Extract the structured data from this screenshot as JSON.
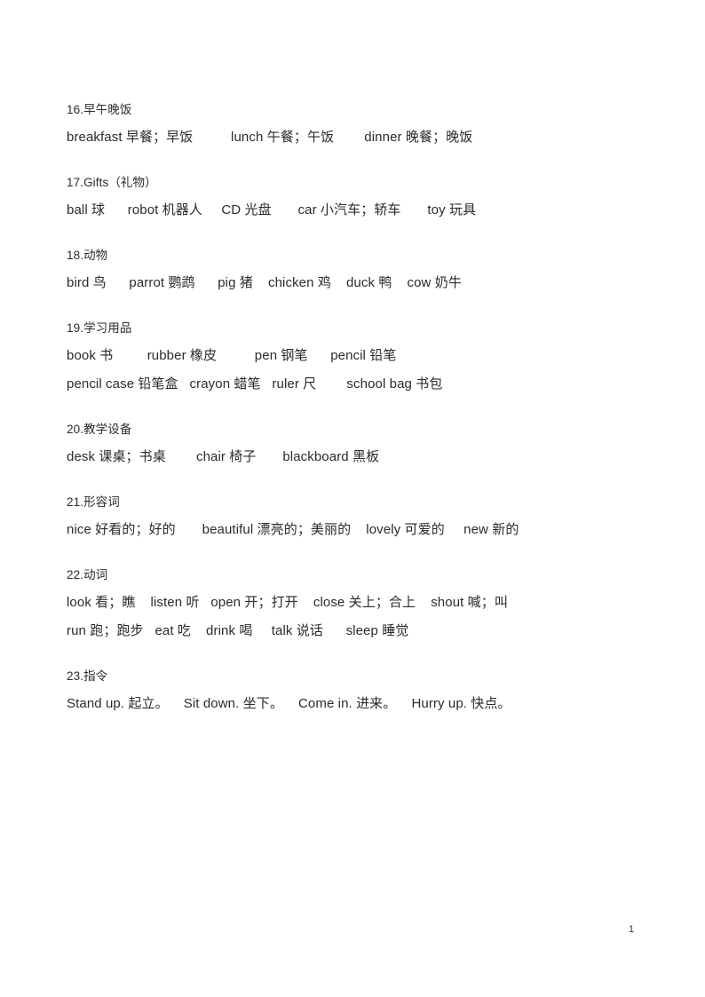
{
  "document": {
    "page_number": "1",
    "background_color": "#ffffff",
    "text_color": "#2b2b2b"
  },
  "sections": [
    {
      "heading": "16.早午晚饭",
      "lines": [
        "breakfast 早餐；早饭          lunch 午餐；午饭        dinner 晚餐；晚饭"
      ],
      "entries": [
        {
          "en": "breakfast",
          "zh": "早餐；早饭"
        },
        {
          "en": "lunch",
          "zh": "午餐；午饭"
        },
        {
          "en": "dinner",
          "zh": "晚餐；晚饭"
        }
      ]
    },
    {
      "heading": "17.Gifts（礼物）",
      "lines": [
        "ball 球      robot 机器人     CD 光盘       car 小汽车；轿车       toy 玩具"
      ],
      "entries": [
        {
          "en": "ball",
          "zh": "球"
        },
        {
          "en": "robot",
          "zh": "机器人"
        },
        {
          "en": "CD",
          "zh": "光盘"
        },
        {
          "en": "car",
          "zh": "小汽车；轿车"
        },
        {
          "en": "toy",
          "zh": "玩具"
        }
      ]
    },
    {
      "heading": "18.动物",
      "lines": [
        "bird 鸟      parrot 鹦鹉      pig 猪    chicken 鸡    duck 鸭    cow 奶牛"
      ],
      "entries": [
        {
          "en": "bird",
          "zh": "鸟"
        },
        {
          "en": "parrot",
          "zh": "鹦鹉"
        },
        {
          "en": "pig",
          "zh": "猪"
        },
        {
          "en": "chicken",
          "zh": "鸡"
        },
        {
          "en": "duck",
          "zh": "鸭"
        },
        {
          "en": "cow",
          "zh": "奶牛"
        }
      ]
    },
    {
      "heading": "19.学习用品",
      "lines": [
        "book 书         rubber 橡皮          pen 钢笔      pencil 铅笔",
        "pencil case 铅笔盒   crayon 蜡笔   ruler 尺        school bag 书包"
      ],
      "entries": [
        {
          "en": "book",
          "zh": "书"
        },
        {
          "en": "rubber",
          "zh": "橡皮"
        },
        {
          "en": "pen",
          "zh": "钢笔"
        },
        {
          "en": "pencil",
          "zh": "铅笔"
        },
        {
          "en": "pencil case",
          "zh": "铅笔盒"
        },
        {
          "en": "crayon",
          "zh": "蜡笔"
        },
        {
          "en": "ruler",
          "zh": "尺"
        },
        {
          "en": "school bag",
          "zh": "书包"
        }
      ]
    },
    {
      "heading": "20.教学设备",
      "lines": [
        "desk 课桌；书桌        chair 椅子       blackboard 黑板"
      ],
      "entries": [
        {
          "en": "desk",
          "zh": "课桌；书桌"
        },
        {
          "en": "chair",
          "zh": "椅子"
        },
        {
          "en": "blackboard",
          "zh": "黑板"
        }
      ]
    },
    {
      "heading": "21.形容词",
      "lines": [
        "nice 好看的；好的       beautiful 漂亮的；美丽的    lovely 可爱的     new 新的"
      ],
      "entries": [
        {
          "en": "nice",
          "zh": "好看的；好的"
        },
        {
          "en": "beautiful",
          "zh": "漂亮的；美丽的"
        },
        {
          "en": "lovely",
          "zh": "可爱的"
        },
        {
          "en": "new",
          "zh": "新的"
        }
      ]
    },
    {
      "heading": "22.动词",
      "lines": [
        "look 看；瞧    listen 听   open 开；打开    close 关上；合上    shout 喊；叫",
        "run 跑；跑步   eat 吃    drink 喝     talk 说话      sleep 睡觉"
      ],
      "entries": [
        {
          "en": "look",
          "zh": "看；瞧"
        },
        {
          "en": "listen",
          "zh": "听"
        },
        {
          "en": "open",
          "zh": "开；打开"
        },
        {
          "en": "close",
          "zh": "关上；合上"
        },
        {
          "en": "shout",
          "zh": "喊；叫"
        },
        {
          "en": "run",
          "zh": "跑；跑步"
        },
        {
          "en": "eat",
          "zh": "吃"
        },
        {
          "en": "drink",
          "zh": "喝"
        },
        {
          "en": "talk",
          "zh": "说话"
        },
        {
          "en": "sleep",
          "zh": "睡觉"
        }
      ]
    },
    {
      "heading": "23.指令",
      "lines": [
        "Stand up. 起立。    Sit down. 坐下。    Come in. 进来。    Hurry up. 快点。"
      ],
      "entries": [
        {
          "en": "Stand up.",
          "zh": "起立。"
        },
        {
          "en": "Sit down.",
          "zh": "坐下。"
        },
        {
          "en": "Come in.",
          "zh": "进来。"
        },
        {
          "en": "Hurry up.",
          "zh": "快点。"
        }
      ]
    }
  ]
}
